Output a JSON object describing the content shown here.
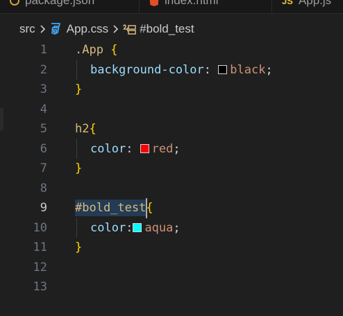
{
  "tabs": [
    {
      "label": "package.json",
      "icon": "json-file-icon"
    },
    {
      "label": "index.html",
      "icon": "html-file-icon"
    },
    {
      "label": "App.js",
      "icon": "js-file-icon",
      "badge": "JS"
    }
  ],
  "breadcrumb": {
    "folder": "src",
    "file": "App.css",
    "symbol": "#bold_test"
  },
  "editor": {
    "active_line": 9,
    "line_numbers": [
      "1",
      "2",
      "3",
      "4",
      "5",
      "6",
      "7",
      "8",
      "9",
      "10",
      "11",
      "12",
      "13"
    ],
    "tokens": {
      "l1_selector": ".App",
      "l1_brace": "{",
      "l2_prop": "background-color",
      "l2_colon": ": ",
      "l2_value": "black",
      "l2_semi": ";",
      "l3_brace": "}",
      "l5_selector": "h2",
      "l5_brace": "{",
      "l6_prop": "color",
      "l6_colon": ": ",
      "l6_value": "red",
      "l6_semi": ";",
      "l7_brace": "}",
      "l9_selector": "#bold_test",
      "l9_brace": "{",
      "l10_prop": "color",
      "l10_colon": ":",
      "l10_value": "aqua",
      "l10_semi": ";",
      "l11_brace": "}"
    },
    "swatch_colors": {
      "black": "#000000",
      "red": "#ff0000",
      "aqua": "#00ffff"
    }
  },
  "theme": {
    "background": "#1f1f1f",
    "selector_color": "#d7ba7d",
    "brace_color": "#ffd700",
    "property_color": "#9cdcfe",
    "value_color": "#ce9178",
    "css_icon_color": "#42a5f5"
  }
}
